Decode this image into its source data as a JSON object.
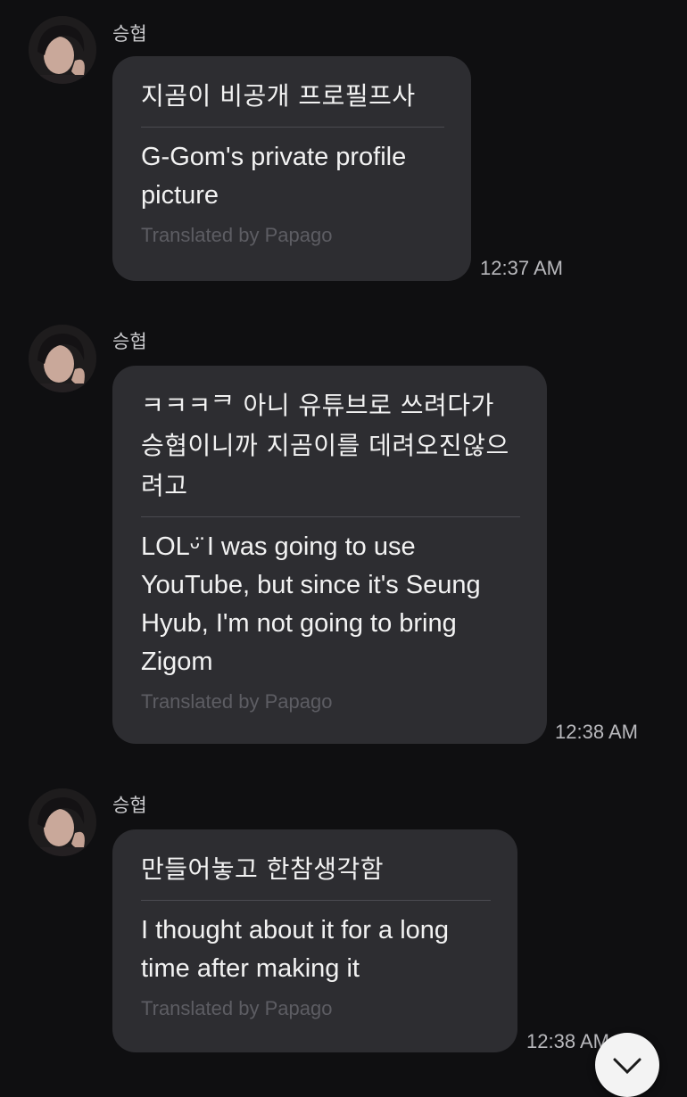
{
  "messages": [
    {
      "sender": "승협",
      "original": "지곰이 비공개 프로필프사",
      "translation": "G-Gom's private profile picture",
      "credit": "Translated by Papago",
      "time": "12:37 AM"
    },
    {
      "sender": "승협",
      "original": "ㅋㅋㅋᄏ 아니 유튜브로 쓰려다가 승협이니까 지곰이를 데려오진않으려고",
      "translation": "LOLᵕ̈ I was going to use YouTube, but since it's Seung Hyub, I'm not going to bring Zigom",
      "credit": "Translated by Papago",
      "time": "12:38 AM"
    },
    {
      "sender": "승협",
      "original": "만들어놓고 한참생각함",
      "translation": "I thought about it for a long time after making it",
      "credit": "Translated by Papago",
      "time": "12:38 AM"
    }
  ],
  "scroll_button": {
    "icon": "chevron-down-icon"
  }
}
